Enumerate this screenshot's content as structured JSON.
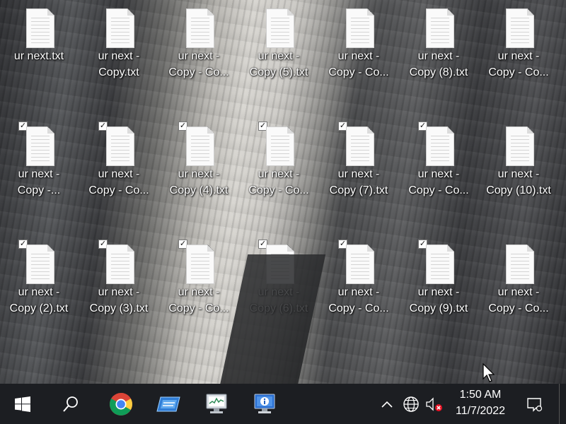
{
  "desktop": {
    "icons": [
      {
        "lines": [
          "ur next.txt"
        ],
        "checked": false
      },
      {
        "lines": [
          "ur next -",
          "Copy.txt"
        ],
        "checked": false
      },
      {
        "lines": [
          "ur next -",
          "Copy - Co..."
        ],
        "checked": false
      },
      {
        "lines": [
          "ur next -",
          "Copy (5).txt"
        ],
        "checked": false
      },
      {
        "lines": [
          "ur next -",
          "Copy - Co..."
        ],
        "checked": false
      },
      {
        "lines": [
          "ur next -",
          "Copy (8).txt"
        ],
        "checked": false
      },
      {
        "lines": [
          "ur next -",
          "Copy - Co..."
        ],
        "checked": false
      },
      {
        "lines": [
          "ur next -",
          "Copy -..."
        ],
        "checked": true
      },
      {
        "lines": [
          "ur next -",
          "Copy - Co..."
        ],
        "checked": true
      },
      {
        "lines": [
          "ur next -",
          "Copy (4).txt"
        ],
        "checked": true
      },
      {
        "lines": [
          "ur next -",
          "Copy - Co..."
        ],
        "checked": true
      },
      {
        "lines": [
          "ur next -",
          "Copy (7).txt"
        ],
        "checked": true
      },
      {
        "lines": [
          "ur next -",
          "Copy - Co..."
        ],
        "checked": true
      },
      {
        "lines": [
          "ur next -",
          "Copy (10).txt"
        ],
        "checked": false
      },
      {
        "lines": [
          "ur next -",
          "Copy (2).txt"
        ],
        "checked": true
      },
      {
        "lines": [
          "ur next -",
          "Copy (3).txt"
        ],
        "checked": true
      },
      {
        "lines": [
          "ur next -",
          "Copy - Co..."
        ],
        "checked": true
      },
      {
        "lines": [
          "ur next -",
          "Copy (6).txt"
        ],
        "checked": true
      },
      {
        "lines": [
          "ur next -",
          "Copy - Co..."
        ],
        "checked": true
      },
      {
        "lines": [
          "ur next -",
          "Copy (9).txt"
        ],
        "checked": true
      },
      {
        "lines": [
          "ur next -",
          "Copy - Co..."
        ],
        "checked": false
      }
    ]
  },
  "taskbar": {
    "buttons": [
      "windows-start-icon",
      "search-icon",
      "chrome-icon",
      "file-explorer-app-icon",
      "task-manager-icon",
      "system-info-icon"
    ],
    "tray": [
      "show-hidden-icons-chevron-icon",
      "network-globe-icon",
      "volume-muted-icon",
      "notifications-icon"
    ],
    "clock": {
      "time": "1:50 AM",
      "date": "11/7/2022"
    }
  },
  "colors": {
    "taskbar": "#1c1e22",
    "label_text": "#ffffff",
    "mute_badge": "#e81123"
  }
}
